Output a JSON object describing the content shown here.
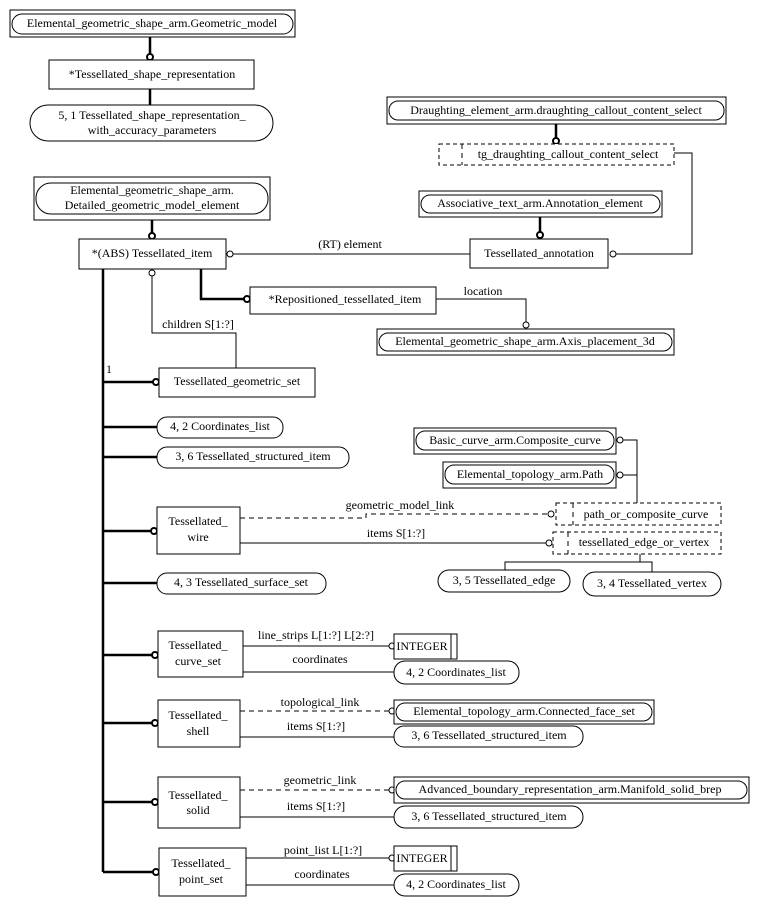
{
  "entities": {
    "geometric_model": "Elemental_geometric_shape_arm.Geometric_model",
    "tess_shape_rep": "*Tessellated_shape_representation",
    "tess_shape_rep_acc_1": "5, 1 Tessellated_shape_representation_",
    "tess_shape_rep_acc_2": "with_accuracy_parameters",
    "detailed_1": "Elemental_geometric_shape_arm.",
    "detailed_2": "Detailed_geometric_model_element",
    "tess_item": "*(ABS) Tessellated_item",
    "draughting_select": "Draughting_element_arm.draughting_callout_content_select",
    "tg_select": "tg_draughting_callout_content_select",
    "annotation_element": "Associative_text_arm.Annotation_element",
    "tess_annotation": "Tessellated_annotation",
    "repositioned": "*Repositioned_tessellated_item",
    "axis_placement": "Elemental_geometric_shape_arm.Axis_placement_3d",
    "geometric_set": "Tessellated_geometric_set",
    "coords_list": "4, 2 Coordinates_list",
    "structured_item": "3, 6 Tessellated_structured_item",
    "composite_curve": "Basic_curve_arm.Composite_curve",
    "path": "Elemental_topology_arm.Path",
    "wire_1": "Tessellated_",
    "wire_2": "wire",
    "path_or_composite": "path_or_composite_curve",
    "edge_or_vertex": "tessellated_edge_or_vertex",
    "tess_edge": "3, 5 Tessellated_edge",
    "tess_vertex": "3, 4 Tessellated_vertex",
    "surface_set": "4, 3 Tessellated_surface_set",
    "curve_set_1": "Tessellated_",
    "curve_set_2": "curve_set",
    "integer": "INTEGER",
    "shell_1": "Tessellated_",
    "shell_2": "shell",
    "connected_face_set": "Elemental_topology_arm.Connected_face_set",
    "solid_1": "Tessellated_",
    "solid_2": "solid",
    "manifold_brep": "Advanced_boundary_representation_arm.Manifold_solid_brep",
    "point_set_1": "Tessellated_",
    "point_set_2": "point_set"
  },
  "relations": {
    "element": "(RT) element",
    "location": "location",
    "children": "children S[1:?]",
    "one": "1",
    "geometric_model_link": "geometric_model_link",
    "items": "items S[1:?]",
    "line_strips": "line_strips L[1:?] L[2:?]",
    "coordinates": "coordinates",
    "topological_link": "topological_link",
    "geometric_link": "geometric_link",
    "point_list": "point_list L[1:?]"
  }
}
